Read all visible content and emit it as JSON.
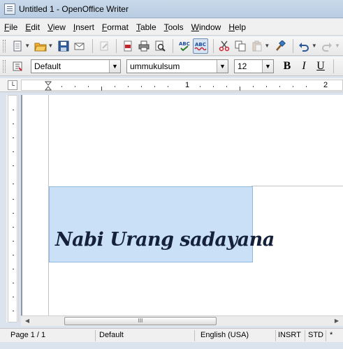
{
  "window": {
    "title": "Untitled 1 - OpenOffice Writer"
  },
  "menu": [
    {
      "label": "File"
    },
    {
      "label": "Edit"
    },
    {
      "label": "View"
    },
    {
      "label": "Insert"
    },
    {
      "label": "Format"
    },
    {
      "label": "Table"
    },
    {
      "label": "Tools"
    },
    {
      "label": "Window"
    },
    {
      "label": "Help"
    }
  ],
  "formatting": {
    "paragraph_style": "Default",
    "font_name": "ummukulsum",
    "font_size": "12",
    "bold_label": "B",
    "italic_label": "I",
    "underline_label": "U"
  },
  "ruler": {
    "mark_1": "1",
    "mark_2": "2"
  },
  "document": {
    "text": "Nabi Urang sadayana"
  },
  "scrollbar": {
    "thumb_grip": "III"
  },
  "status": {
    "page": "Page 1 / 1",
    "page_style": "Default",
    "language": "English (USA)",
    "insert_mode": "INSRT",
    "selection_mode": "STD",
    "modified": "*"
  },
  "colors": {
    "selection": "#c9e0f7",
    "text": "#15213a"
  }
}
